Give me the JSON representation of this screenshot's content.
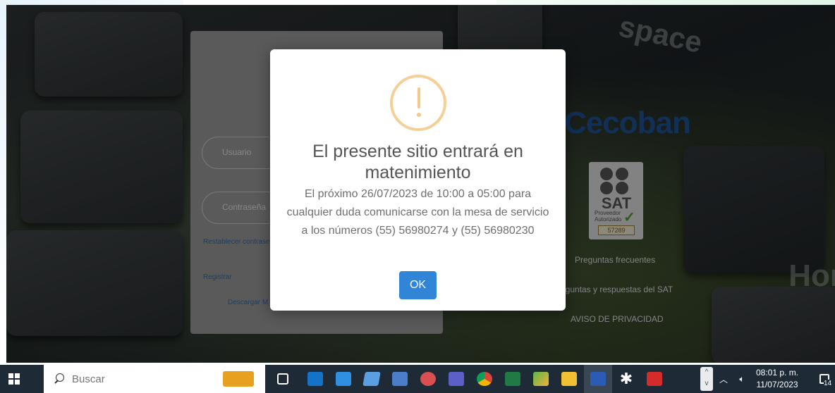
{
  "background": {
    "watermark_top": "space",
    "watermark_right": "Hor",
    "brand": "Cecoban"
  },
  "login": {
    "user_placeholder": "Usuario",
    "password_placeholder": "Contraseña",
    "reset_link": "Restablecer contrase",
    "register_link": "Registrar",
    "download_link": "Descargar M"
  },
  "side": {
    "sat_badge": {
      "logo_text": "SAT",
      "provider_line1": "Proveedor",
      "provider_line2": "Autorizado",
      "number": "57289"
    },
    "faq_link": "Preguntas frecuentes",
    "sat_faq_link": "eguntas y respuestas del SAT",
    "privacy_link": "AVISO DE PRIVACIDAD"
  },
  "modal": {
    "icon": "warning-icon",
    "title": "El presente sitio entrará en matenimiento",
    "message": "El próximo 26/07/2023 de 10:00 a 05:00 para cualquier duda comunicarse con la mesa de servicio a los números (55) 56980274 y (55) 56980230",
    "ok_label": "OK",
    "accent_color": "#3085d6",
    "icon_color": "#f8bb86"
  },
  "taskbar": {
    "search_placeholder": "Buscar",
    "apps": [
      "files-icon",
      "task-view-icon",
      "outlook-icon",
      "mail-icon",
      "onenote-icon",
      "calculator-icon",
      "snip-icon",
      "teams-icon",
      "chrome-icon",
      "excel-icon",
      "project-icon",
      "file-explorer-icon",
      "word-icon",
      "settings-icon",
      "acrobat-icon"
    ],
    "time": "08:01 p. m.",
    "date": "11/07/2023",
    "notification_count": "14"
  }
}
